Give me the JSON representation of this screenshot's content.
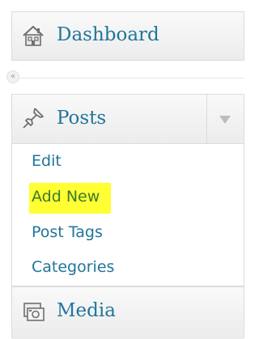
{
  "menu": {
    "dashboard": {
      "label": "Dashboard",
      "icon": "home-icon"
    },
    "collapse": {
      "glyph": "«",
      "icon": "collapse-arrow-icon"
    },
    "posts": {
      "label": "Posts",
      "icon": "pushpin-icon",
      "toggle_icon": "dropdown-arrow-icon",
      "items": [
        {
          "label": "Edit"
        },
        {
          "label": "Add New",
          "highlighted": true
        },
        {
          "label": "Post Tags"
        },
        {
          "label": "Categories"
        }
      ]
    },
    "media": {
      "label": "Media",
      "icon": "media-camera-icon"
    }
  },
  "colors": {
    "link": "#21759b",
    "highlight_bg": "#ffff33",
    "highlight_text": "#3a7a2a"
  }
}
